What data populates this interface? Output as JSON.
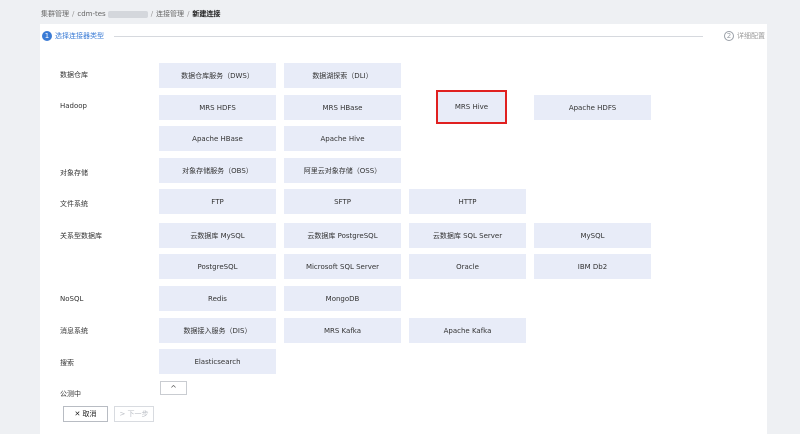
{
  "breadcrumb": {
    "item1": "集群管理",
    "sep": "/",
    "item2": "cdm-tes",
    "item3": "连接管理",
    "item4": "新建连接"
  },
  "steps": {
    "step1_num": "1",
    "step1_label": "选择连接器类型",
    "step2_num": "2",
    "step2_label": "详细配置"
  },
  "categories": {
    "dw": "数据仓库",
    "hadoop": "Hadoop",
    "obj": "对象存储",
    "fs": "文件系统",
    "rdb": "关系型数据库",
    "nosql": "NoSQL",
    "mq": "消息系统",
    "search": "搜索",
    "beta": "公测中"
  },
  "options": {
    "dws": "数据仓库服务（DWS）",
    "dli": "数据湖探索（DLI）",
    "mrs_hdfs": "MRS HDFS",
    "mrs_hbase": "MRS HBase",
    "mrs_hive": "MRS Hive",
    "apache_hdfs": "Apache HDFS",
    "apache_hbase": "Apache HBase",
    "apache_hive": "Apache Hive",
    "obs": "对象存储服务（OBS）",
    "oss": "阿里云对象存储（OSS）",
    "ftp": "FTP",
    "sftp": "SFTP",
    "http": "HTTP",
    "cloud_mysql": "云数据库 MySQL",
    "cloud_pg": "云数据库 PostgreSQL",
    "cloud_sqlserver": "云数据库 SQL Server",
    "mysql": "MySQL",
    "postgresql": "PostgreSQL",
    "mssql": "Microsoft SQL Server",
    "oracle": "Oracle",
    "db2": "IBM Db2",
    "redis": "Redis",
    "mongodb": "MongoDB",
    "dis": "数据接入服务（DIS）",
    "mrs_kafka": "MRS Kafka",
    "apache_kafka": "Apache Kafka",
    "elasticsearch": "Elasticsearch"
  },
  "collapse_icon": "^",
  "buttons": {
    "cancel": "✕ 取消",
    "next": "> 下一步"
  }
}
